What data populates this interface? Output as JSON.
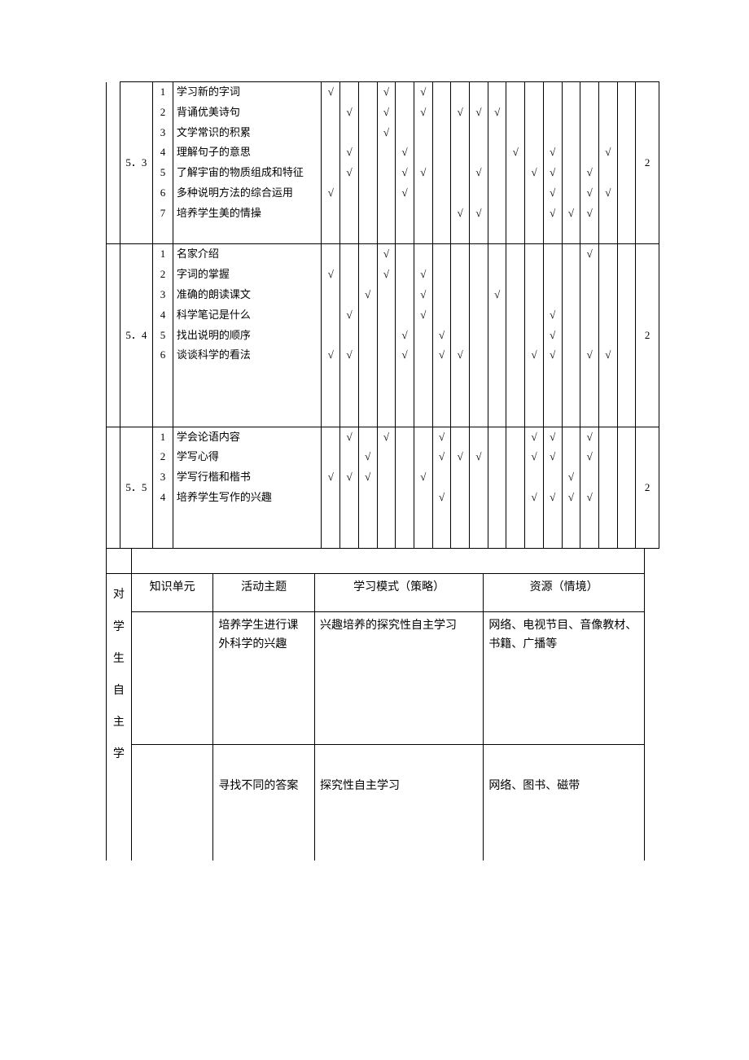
{
  "top_sections": [
    {
      "id": "5．3",
      "hours": "2",
      "rows": [
        {
          "n": "1",
          "desc": "学习新的字词",
          "c": [
            "√",
            "",
            "",
            "√",
            "",
            "√",
            "",
            "",
            "",
            "",
            "",
            "",
            "",
            "",
            "",
            "",
            ""
          ]
        },
        {
          "n": "2",
          "desc": "背诵优美诗句",
          "c": [
            "",
            "√",
            "",
            "√",
            "",
            "√",
            "",
            "√",
            "√",
            "√",
            "",
            "",
            "",
            "",
            "",
            "",
            ""
          ]
        },
        {
          "n": "3",
          "desc": "文学常识的积累",
          "c": [
            "",
            "",
            "",
            "√",
            "",
            "",
            "",
            "",
            "",
            "",
            "",
            "",
            "",
            "",
            "",
            "",
            ""
          ]
        },
        {
          "n": "4",
          "desc": "理解句子的意思",
          "c": [
            "",
            "√",
            "",
            "",
            "√",
            "",
            "",
            "",
            "",
            "",
            "√",
            "",
            "√",
            "",
            "",
            "√",
            ""
          ]
        },
        {
          "n": "5",
          "desc": "了解宇宙的物质组成和特征",
          "c": [
            "",
            "√",
            "",
            "",
            "√",
            "√",
            "",
            "",
            "√",
            "",
            "",
            "√",
            "√",
            "",
            "√",
            "",
            ""
          ]
        },
        {
          "n": "6",
          "desc": "多种说明方法的综合运用",
          "c": [
            "√",
            "",
            "",
            "",
            "√",
            "",
            "",
            "",
            "",
            "",
            "",
            "",
            "√",
            "",
            "√",
            "√",
            ""
          ]
        },
        {
          "n": "7",
          "desc": "培养学生美的情操",
          "c": [
            "",
            "",
            "",
            "",
            "",
            "",
            "",
            "√",
            "√",
            "",
            "",
            "",
            "√",
            "√",
            "√",
            "",
            ""
          ]
        }
      ]
    },
    {
      "id": "5．4",
      "hours": "2",
      "rows": [
        {
          "n": "1",
          "desc": "名家介绍",
          "c": [
            "",
            "",
            "",
            "√",
            "",
            "",
            "",
            "",
            "",
            "",
            "",
            "",
            "",
            "",
            "√",
            "",
            ""
          ]
        },
        {
          "n": "2",
          "desc": "字词的掌握",
          "c": [
            "√",
            "",
            "",
            "√",
            "",
            "√",
            "",
            "",
            "",
            "",
            "",
            "",
            "",
            "",
            "",
            "",
            ""
          ]
        },
        {
          "n": "3",
          "desc": "准确的朗读课文",
          "c": [
            "",
            "",
            "√",
            "",
            "",
            "√",
            "",
            "",
            "",
            "√",
            "",
            "",
            "",
            "",
            "",
            "",
            ""
          ]
        },
        {
          "n": "4",
          "desc": "科学笔记是什么",
          "c": [
            "",
            "√",
            "",
            "",
            "",
            "√",
            "",
            "",
            "",
            "",
            "",
            "",
            "√",
            "",
            "",
            "",
            ""
          ]
        },
        {
          "n": "5",
          "desc": "找出说明的顺序",
          "c": [
            "",
            "",
            "",
            "",
            "√",
            "",
            "√",
            "",
            "",
            "",
            "",
            "",
            "√",
            "",
            "",
            "",
            ""
          ]
        },
        {
          "n": "6",
          "desc": "谈谈科学的看法",
          "c": [
            "√",
            "√",
            "",
            "",
            "√",
            "",
            "√",
            "√",
            "",
            "",
            "",
            "√",
            "√",
            "",
            "√",
            "√",
            ""
          ]
        }
      ]
    },
    {
      "id": "5．5",
      "hours": "2",
      "rows": [
        {
          "n": "1",
          "desc": "学会论语内容",
          "c": [
            "",
            "√",
            "",
            "√",
            "",
            "",
            "√",
            "",
            "",
            "",
            "",
            "√",
            "√",
            "",
            "√",
            "",
            ""
          ]
        },
        {
          "n": "2",
          "desc": "学写心得",
          "c": [
            "",
            "",
            "√",
            "",
            "",
            "",
            "√",
            "√",
            "√",
            "",
            "",
            "√",
            "√",
            "",
            "√",
            "",
            ""
          ]
        },
        {
          "n": "3",
          "desc": "学写行楷和楷书",
          "c": [
            "√",
            "√",
            "√",
            "",
            "",
            "√",
            "",
            "",
            "",
            "",
            "",
            "",
            "",
            "√",
            "",
            "",
            ""
          ]
        },
        {
          "n": "4",
          "desc": "培养学生写作的兴趣",
          "c": [
            "",
            "",
            "",
            "",
            "",
            "",
            "√",
            "",
            "",
            "",
            "",
            "√",
            "√",
            "√",
            "√",
            "",
            ""
          ]
        }
      ]
    }
  ],
  "bottom": {
    "vlabel": "对学生自主学",
    "headers": {
      "ku": "知识单元",
      "act": "活动主题",
      "mode": "学习模式（策略）",
      "res": "资源（情境）"
    },
    "rows": [
      {
        "ku": "",
        "act": "培养学生进行课外科学的兴趣",
        "mode": "兴趣培养的探究性自主学习",
        "res": "网络、电视节目、音像教材、书籍、广播等"
      },
      {
        "ku": "",
        "act": "寻找不同的答案",
        "mode": "探究性自主学习",
        "res": " 网络、图书、磁带"
      }
    ]
  }
}
